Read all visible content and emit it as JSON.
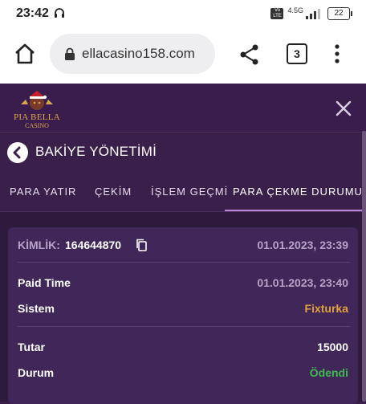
{
  "status_bar": {
    "time": "23:42",
    "network": "4.5G",
    "volte_line1": "Vo",
    "volte_line2": "LTE",
    "battery": "22"
  },
  "browser": {
    "url": "ellacasino158.com",
    "tab_count": "3"
  },
  "site": {
    "logo_name": "PIA BELLA",
    "logo_sub": "CASINO"
  },
  "page": {
    "title": "BAKİYE YÖNETİMİ"
  },
  "tabs": [
    {
      "label": "PARA YATIR",
      "active": false
    },
    {
      "label": "ÇEKİM",
      "active": false
    },
    {
      "label": "İŞLEM GEÇMİ",
      "active": false
    },
    {
      "label": "PARA ÇEKME DURUMU",
      "active": true
    }
  ],
  "withdrawal": {
    "id_label": "KİMLİK:",
    "id_value": "164644870",
    "created": "01.01.2023, 23:39",
    "paid_time_label": "Paid Time",
    "paid_time": "01.01.2023, 23:40",
    "system_label": "Sistem",
    "system": "Fixturka",
    "amount_label": "Tutar",
    "amount": "15000",
    "status_label": "Durum",
    "status": "Ödendi"
  },
  "colors": {
    "background": "#3a1f4a",
    "card": "#41265a",
    "system_value": "#e0a23a",
    "status_paid": "#3fb950",
    "tab_active_underline": "#b888d8"
  }
}
